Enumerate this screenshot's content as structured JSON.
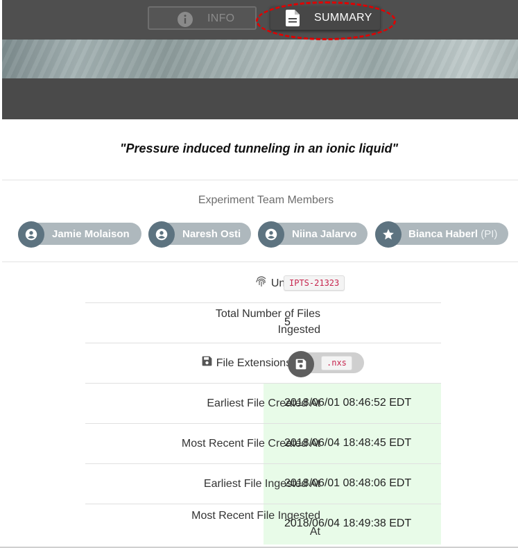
{
  "nav": {
    "tabs": [
      {
        "label": "INFO",
        "icon": "info-icon",
        "active": false
      },
      {
        "label": "SUMMARY",
        "icon": "document-icon",
        "active": true
      }
    ]
  },
  "title": "\"Pressure induced tunneling in an ionic liquid\"",
  "team": {
    "heading": "Experiment Team Members",
    "members": [
      {
        "name": "Jamie Molaison",
        "role": "",
        "icon": "account-circle-icon"
      },
      {
        "name": "Naresh Osti",
        "role": "",
        "icon": "account-circle-icon"
      },
      {
        "name": "Niina Jalarvo",
        "role": "",
        "icon": "account-circle-icon"
      },
      {
        "name": "Bianca Haberl",
        "role": "(PI)",
        "icon": "star-icon"
      }
    ]
  },
  "details": {
    "unique_id": {
      "label": "Unique ID",
      "icon": "fingerprint-icon",
      "value": "IPTS-21323"
    },
    "total_files": {
      "label_line1": "Total Number of Files",
      "label_line2": "Ingested",
      "value": "5"
    },
    "file_extensions": {
      "label": "File Extensions Used",
      "icon": "save-icon",
      "values": [
        ".nxs"
      ]
    },
    "dates": [
      {
        "label": "Earliest File Created At",
        "value": "2018/06/01 08:46:52 EDT"
      },
      {
        "label": "Most Recent File Created At",
        "value": "2018/06/04 18:48:45 EDT"
      },
      {
        "label": "Earliest File Ingested At",
        "value": "2018/06/01 08:48:06 EDT"
      },
      {
        "label_line1": "Most Recent File Ingested",
        "label_line2": "At",
        "value": "2018/06/04 18:49:38 EDT"
      }
    ]
  },
  "colors": {
    "header_bg": "#4f4f4f",
    "chip_bg": "#aeb8bd",
    "chip_avatar": "#5d7380",
    "highlight": "#e00000",
    "date_bg": "#e8fbe8",
    "code_text": "#c7254e"
  }
}
